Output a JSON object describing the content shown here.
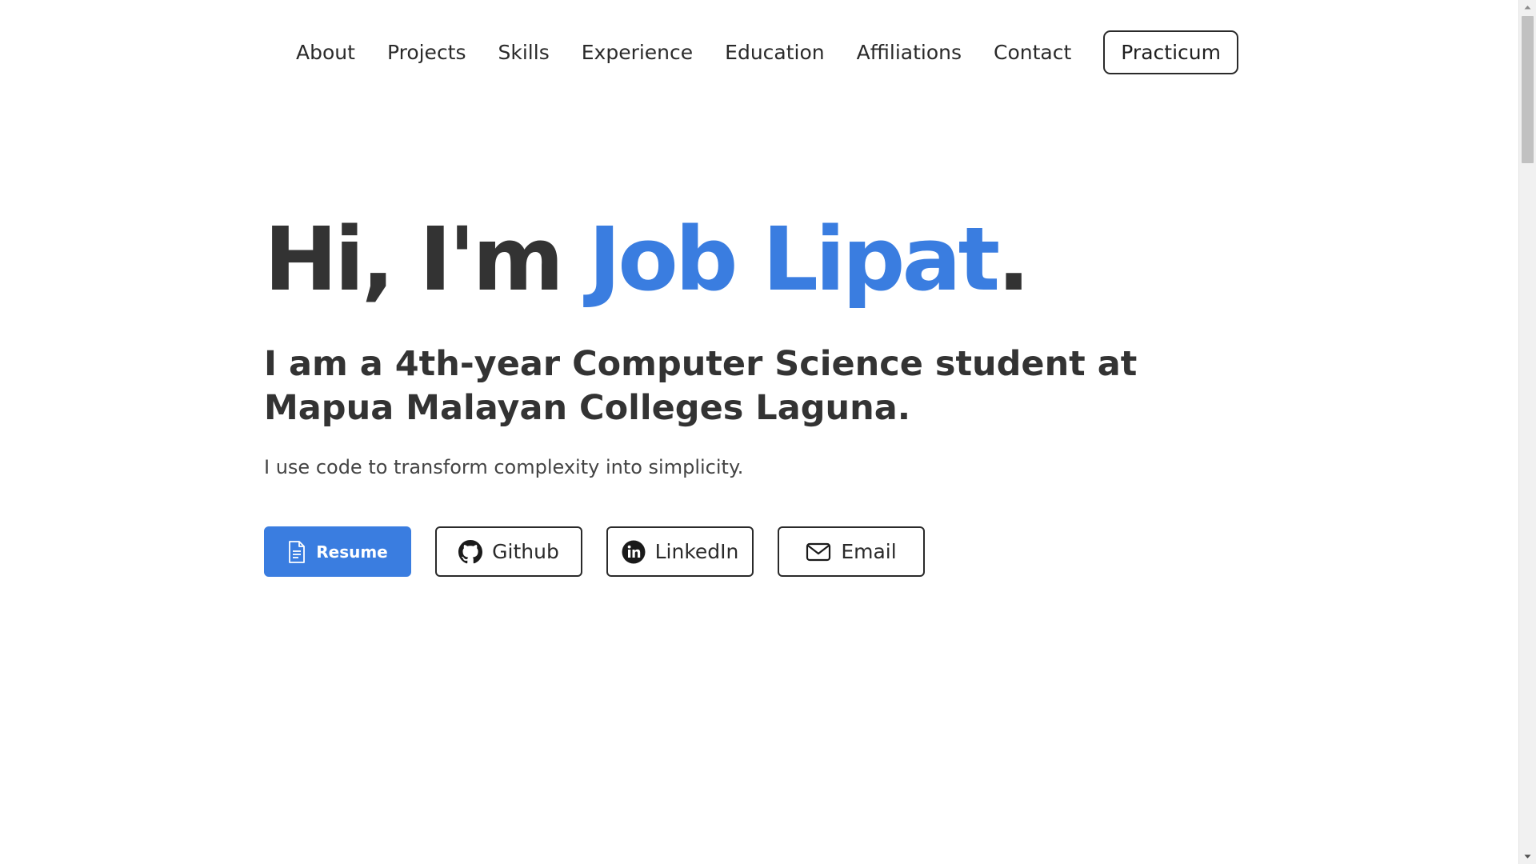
{
  "nav": {
    "links": [
      "About",
      "Projects",
      "Skills",
      "Experience",
      "Education",
      "Affiliations",
      "Contact"
    ],
    "cta_label": "Practicum"
  },
  "hero": {
    "greeting": "Hi, I'm",
    "name": "Job Lipat",
    "period": ".",
    "subtitle": "I am a 4th-year Computer Science student at Mapua Malayan Colleges Laguna.",
    "tagline": "I use code to transform complexity into simplicity."
  },
  "buttons": {
    "resume": {
      "label": "Resume",
      "icon": "document-icon"
    },
    "github": {
      "label": "Github",
      "icon": "github-icon"
    },
    "linkedin": {
      "label": "LinkedIn",
      "icon": "linkedin-icon"
    },
    "email": {
      "label": "Email",
      "icon": "mail-icon"
    }
  },
  "colors": {
    "accent": "#3a7de0",
    "text": "#333333"
  }
}
